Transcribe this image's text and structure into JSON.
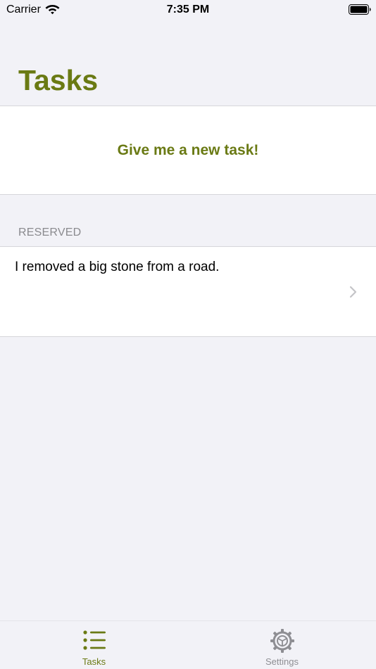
{
  "status_bar": {
    "carrier": "Carrier",
    "time": "7:35 PM",
    "icons": [
      "wifi-icon",
      "battery-icon"
    ]
  },
  "header": {
    "title": "Tasks"
  },
  "new_task": {
    "label": "Give me a new task!"
  },
  "reserved_section": {
    "header": "RESERVED",
    "items": [
      {
        "text": "I removed a big stone from a road."
      }
    ]
  },
  "tab_bar": {
    "tabs": [
      {
        "label": "Tasks",
        "icon": "list-icon",
        "selected": true
      },
      {
        "label": "Settings",
        "icon": "gear-icon",
        "selected": false
      }
    ]
  },
  "colors": {
    "accent": "#6a7a14",
    "background": "#f2f2f7",
    "cell_background": "#ffffff",
    "section_header": "#8a8a8e",
    "tab_inactive": "#8e8e93",
    "chevron": "#c4c4c7"
  }
}
